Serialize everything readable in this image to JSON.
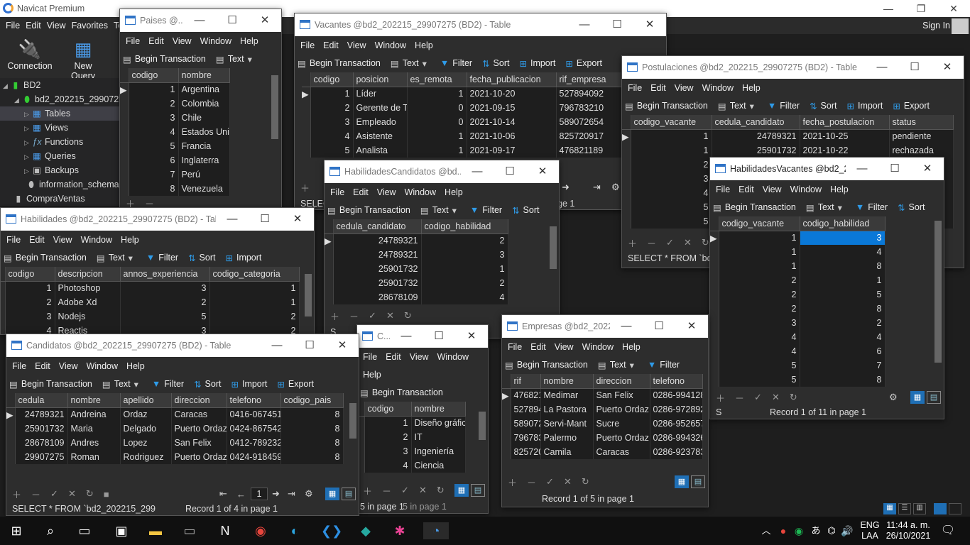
{
  "app": {
    "title": "Navicat Premium",
    "menu": [
      "File",
      "Edit",
      "View",
      "Favorites",
      "To"
    ],
    "sign_in": "Sign In",
    "window_controls": [
      "—",
      "❐",
      "✕"
    ],
    "toolbar": {
      "connection": "Connection",
      "new_query": "New Query",
      "partial_label": "U"
    }
  },
  "nav": {
    "connection": "BD2",
    "database": "bd2_202215_29907275",
    "items": [
      "Tables",
      "Views",
      "Functions",
      "Queries",
      "Backups"
    ],
    "other_dbs": [
      "information_schema"
    ],
    "other_connection": "CompraVentas"
  },
  "common": {
    "begin_transaction": "Begin Transaction",
    "text": "Text",
    "filter": "Filter",
    "sort": "Sort",
    "import": "Import",
    "export": "Export"
  },
  "windows": {
    "paises": {
      "title": "Paises @...",
      "menu": [
        "File",
        "Edit",
        "View",
        "Window",
        "Help"
      ],
      "columns": [
        "codigo",
        "nombre"
      ],
      "rows": [
        [
          "1",
          "Argentina"
        ],
        [
          "2",
          "Colombia"
        ],
        [
          "3",
          "Chile"
        ],
        [
          "4",
          "Estados Unido"
        ],
        [
          "5",
          "Francia"
        ],
        [
          "6",
          "Inglaterra"
        ],
        [
          "7",
          "Perú"
        ],
        [
          "8",
          "Venezuela"
        ]
      ]
    },
    "vacantes": {
      "title": "Vacantes @bd2_202215_29907275 (BD2) - Table",
      "menu": [
        "File",
        "Edit",
        "View",
        "Window",
        "Help"
      ],
      "columns": [
        "codigo",
        "posicion",
        "es_remota",
        "fecha_publicacion",
        "rif_empresa"
      ],
      "rows": [
        [
          "1",
          "Líder",
          "1",
          "2021-10-20",
          "527894092"
        ],
        [
          "2",
          "Gerente de TI",
          "0",
          "2021-09-15",
          "796783210"
        ],
        [
          "3",
          "Empleado",
          "0",
          "2021-10-14",
          "589072654"
        ],
        [
          "4",
          "Asistente",
          "1",
          "2021-10-06",
          "825720917"
        ],
        [
          "5",
          "Analista",
          "1",
          "2021-09-17",
          "476821189"
        ]
      ],
      "sql": "SELECT",
      "partial_record": "ge 1"
    },
    "postulaciones": {
      "title": "Postulaciones @bd2_202215_29907275 (BD2) - Table",
      "menu": [
        "File",
        "Edit",
        "View",
        "Window",
        "Help"
      ],
      "columns": [
        "codigo_vacante",
        "cedula_candidato",
        "fecha_postulacion",
        "status"
      ],
      "rows": [
        [
          "1",
          "24789321",
          "2021-10-25",
          "pendiente"
        ],
        [
          "1",
          "25901732",
          "2021-10-22",
          "rechazada"
        ],
        [
          "2",
          "",
          "",
          ""
        ],
        [
          "3",
          "",
          "",
          ""
        ],
        [
          "4",
          "",
          "",
          ""
        ],
        [
          "5",
          "",
          "",
          ""
        ],
        [
          "5",
          "",
          "",
          ""
        ]
      ],
      "sql": "SELECT * FROM `bd2_2"
    },
    "habcand": {
      "title": "HabilidadesCandidatos @bd...",
      "menu": [
        "File",
        "Edit",
        "View",
        "Window",
        "Help"
      ],
      "columns": [
        "cedula_candidato",
        "codigo_habilidad"
      ],
      "rows": [
        [
          "24789321",
          "2"
        ],
        [
          "24789321",
          "3"
        ],
        [
          "25901732",
          "1"
        ],
        [
          "25901732",
          "2"
        ],
        [
          "28678109",
          "4"
        ]
      ],
      "sql": "S"
    },
    "habvac": {
      "title": "HabilidadesVacantes @bd2_2...",
      "menu": [
        "File",
        "Edit",
        "View",
        "Window",
        "Help"
      ],
      "columns": [
        "codigo_vacante",
        "codigo_habilidad"
      ],
      "rows": [
        [
          "1",
          "3"
        ],
        [
          "1",
          "4"
        ],
        [
          "1",
          "8"
        ],
        [
          "2",
          "1"
        ],
        [
          "2",
          "5"
        ],
        [
          "2",
          "8"
        ],
        [
          "3",
          "2"
        ],
        [
          "4",
          "4"
        ],
        [
          "4",
          "6"
        ],
        [
          "5",
          "7"
        ],
        [
          "5",
          "8"
        ]
      ],
      "sql": "S",
      "record": "Record 1 of 11 in page 1"
    },
    "habilidades": {
      "title": "Habilidades @bd2_202215_29907275 (BD2) - Table",
      "menu": [
        "File",
        "Edit",
        "View",
        "Window",
        "Help"
      ],
      "columns": [
        "codigo",
        "descripcion",
        "annos_experiencia",
        "codigo_categoria"
      ],
      "rows": [
        [
          "1",
          "Photoshop",
          "3",
          "1"
        ],
        [
          "2",
          "Adobe Xd",
          "2",
          "1"
        ],
        [
          "3",
          "Nodejs",
          "5",
          "2"
        ],
        [
          "4",
          "Reactjs",
          "3",
          "2"
        ]
      ]
    },
    "candidatos": {
      "title": "Candidatos @bd2_202215_29907275 (BD2) - Table",
      "menu": [
        "File",
        "Edit",
        "View",
        "Window",
        "Help"
      ],
      "columns": [
        "cedula",
        "nombre",
        "apellido",
        "direccion",
        "telefono",
        "codigo_pais"
      ],
      "rows": [
        [
          "24789321",
          "Andreina",
          "Ordaz",
          "Caracas",
          "0416-0674511",
          "8"
        ],
        [
          "25901732",
          "Maria",
          "Delgado",
          "Puerto Ordaz",
          "0424-8675421",
          "8"
        ],
        [
          "28678109",
          "Andres",
          "Lopez",
          "San Felix",
          "0412-7892321",
          "8"
        ],
        [
          "29907275",
          "Roman",
          "Rodriguez",
          "Puerto Ordaz",
          "0424-9184591",
          "8"
        ]
      ],
      "page": "1",
      "sql": "SELECT * FROM `bd2_202215_299",
      "record": "Record 1 of 4 in page 1"
    },
    "categorias": {
      "title": "C...",
      "menu": [
        "File",
        "Edit",
        "View",
        "Window",
        "Help"
      ],
      "columns": [
        "codigo",
        "nombre"
      ],
      "rows": [
        [
          "1",
          "Diseño gráfic"
        ],
        [
          "2",
          "IT"
        ],
        [
          "3",
          "Ingeniería"
        ],
        [
          "4",
          "Ciencia"
        ]
      ],
      "record": "5 in page 1",
      "record_behind": "5 in page 1"
    },
    "empresas": {
      "title": "Empresas @bd2_202215...",
      "menu": [
        "File",
        "Edit",
        "View",
        "Window",
        "Help"
      ],
      "columns": [
        "rif",
        "nombre",
        "direccion",
        "telefono"
      ],
      "rows": [
        [
          "476821",
          "Medimar",
          "San Felix",
          "0286-9941287"
        ],
        [
          "527894",
          "La Pastora",
          "Puerto Ordaz",
          "0286-9728922"
        ],
        [
          "589072",
          "Servi-Mant",
          "Sucre",
          "0286-9526572"
        ],
        [
          "796783",
          "Palermo",
          "Puerto Ordaz",
          "0286-9943267"
        ],
        [
          "825720",
          "Camila",
          "Caracas",
          "0286-9237831"
        ]
      ],
      "record": "Record 1 of 5 in page 1"
    }
  },
  "taskbar": {
    "lang": "ENG",
    "lang2": "LAA",
    "time": "11:44 a. m.",
    "date": "26/10/2021"
  }
}
